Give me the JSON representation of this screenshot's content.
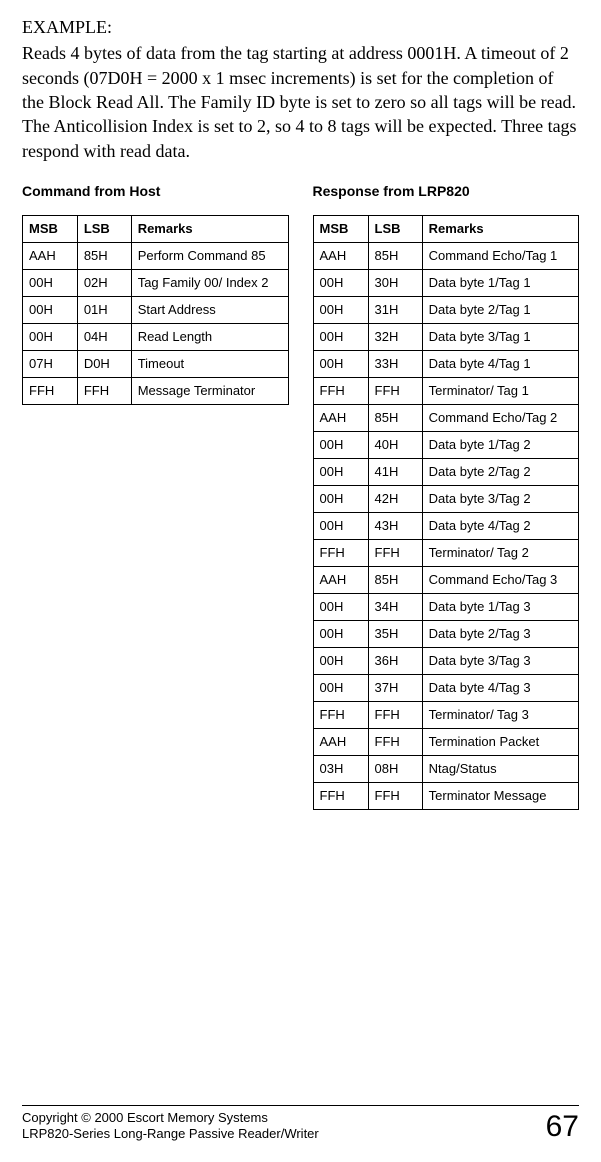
{
  "example": {
    "label": "EXAMPLE:",
    "body": "Reads 4 bytes of data from the tag starting at address 0001H. A timeout of 2 seconds (07D0H = 2000 x 1 msec increments) is set for the completion of the Block Read All. The Family ID byte is set to zero so all tags will be read. The Anticollision Index is set to 2, so 4 to 8 tags will be expected.  Three tags respond with read data."
  },
  "host": {
    "title": "Command from Host",
    "headers": {
      "msb": "MSB",
      "lsb": "LSB",
      "remarks": "Remarks"
    },
    "rows": [
      {
        "msb": "AAH",
        "lsb": "85H",
        "remarks": "Perform Command 85"
      },
      {
        "msb": "00H",
        "lsb": "02H",
        "remarks": "Tag Family 00/ Index 2"
      },
      {
        "msb": "00H",
        "lsb": "01H",
        "remarks": "Start Address"
      },
      {
        "msb": "00H",
        "lsb": "04H",
        "remarks": "Read Length"
      },
      {
        "msb": "07H",
        "lsb": "D0H",
        "remarks": "Timeout"
      },
      {
        "msb": "FFH",
        "lsb": "FFH",
        "remarks": "Message Terminator"
      }
    ]
  },
  "resp": {
    "title": "Response from LRP820",
    "headers": {
      "msb": "MSB",
      "lsb": "LSB",
      "remarks": "Remarks"
    },
    "rows": [
      {
        "msb": "AAH",
        "lsb": "85H",
        "remarks": "Command Echo/Tag 1"
      },
      {
        "msb": "00H",
        "lsb": "30H",
        "remarks": "Data byte 1/Tag 1"
      },
      {
        "msb": "00H",
        "lsb": "31H",
        "remarks": "Data byte 2/Tag 1"
      },
      {
        "msb": "00H",
        "lsb": "32H",
        "remarks": "Data byte 3/Tag 1"
      },
      {
        "msb": "00H",
        "lsb": "33H",
        "remarks": "Data byte 4/Tag 1"
      },
      {
        "msb": "FFH",
        "lsb": "FFH",
        "remarks": "Terminator/ Tag 1"
      },
      {
        "msb": "AAH",
        "lsb": "85H",
        "remarks": "Command Echo/Tag 2"
      },
      {
        "msb": "00H",
        "lsb": "40H",
        "remarks": "Data byte 1/Tag 2"
      },
      {
        "msb": "00H",
        "lsb": "41H",
        "remarks": "Data byte 2/Tag 2"
      },
      {
        "msb": "00H",
        "lsb": "42H",
        "remarks": "Data byte 3/Tag 2"
      },
      {
        "msb": "00H",
        "lsb": "43H",
        "remarks": "Data byte 4/Tag 2"
      },
      {
        "msb": "FFH",
        "lsb": "FFH",
        "remarks": "Terminator/ Tag 2"
      },
      {
        "msb": "AAH",
        "lsb": "85H",
        "remarks": "Command Echo/Tag 3"
      },
      {
        "msb": "00H",
        "lsb": "34H",
        "remarks": "Data byte 1/Tag 3"
      },
      {
        "msb": "00H",
        "lsb": "35H",
        "remarks": "Data byte 2/Tag 3"
      },
      {
        "msb": "00H",
        "lsb": "36H",
        "remarks": "Data byte 3/Tag 3"
      },
      {
        "msb": "00H",
        "lsb": "37H",
        "remarks": "Data byte 4/Tag 3"
      },
      {
        "msb": "FFH",
        "lsb": "FFH",
        "remarks": "Terminator/ Tag 3"
      },
      {
        "msb": "AAH",
        "lsb": "FFH",
        "remarks": "Termination Packet"
      },
      {
        "msb": "03H",
        "lsb": "08H",
        "remarks": "Ntag/Status"
      },
      {
        "msb": "FFH",
        "lsb": "FFH",
        "remarks": "Terminator Message"
      }
    ]
  },
  "footer": {
    "line1": "Copyright © 2000 Escort Memory Systems",
    "line2": "LRP820-Series Long-Range Passive Reader/Writer",
    "page": "67"
  }
}
